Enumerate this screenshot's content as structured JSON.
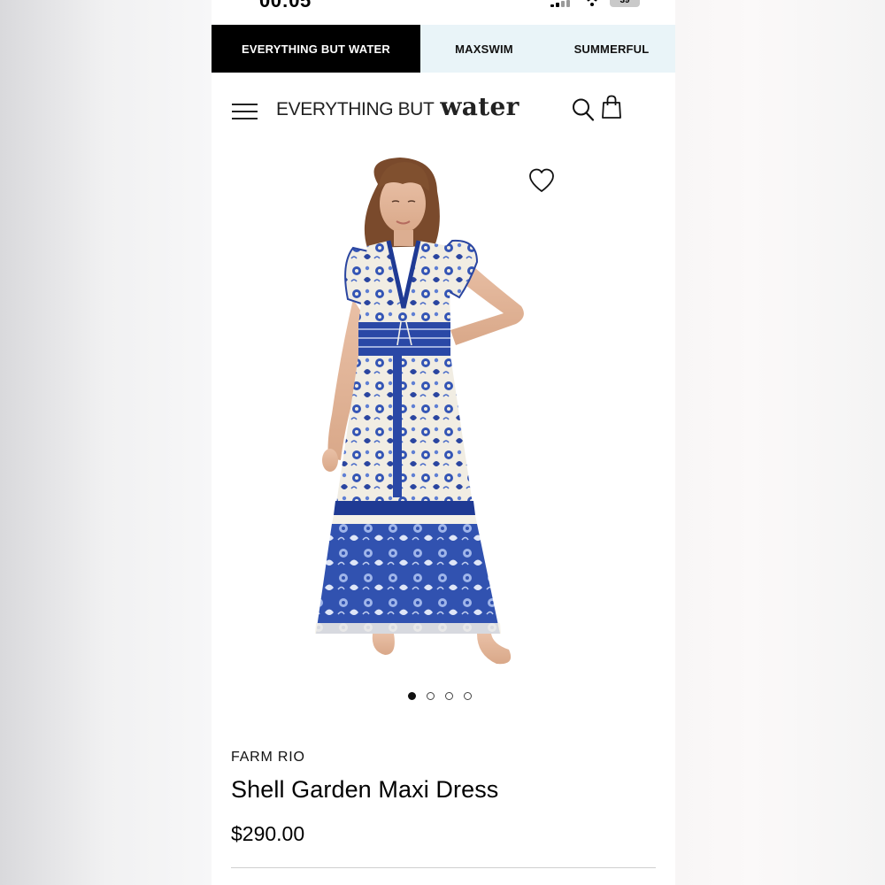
{
  "status_bar": {
    "time": "00:05",
    "battery": "39"
  },
  "brand_tabs": [
    {
      "label": "EVERYTHING BUT WATER",
      "active": true
    },
    {
      "label": "MAXSWIM",
      "active": false
    },
    {
      "label": "SUMMERFUL",
      "active": false
    }
  ],
  "header": {
    "logo_main": "EVERYTHING BUT",
    "logo_script": "water",
    "icons": [
      "menu-icon",
      "search-icon",
      "shopping-bag-icon"
    ]
  },
  "product": {
    "image_alt": "Shell Garden Maxi Dress",
    "wishlist_icon": "heart-icon",
    "carousel": {
      "total": 4,
      "current": 1
    },
    "brand": "FARM RIO",
    "name": "Shell Garden Maxi Dress",
    "price": "$290.00"
  },
  "colors": {
    "active_tab_bg": "#000000",
    "tab_bar_bg": "#e9f4f8",
    "dress_blue": "#2f4fb0",
    "dress_cream": "#f3efe6"
  }
}
